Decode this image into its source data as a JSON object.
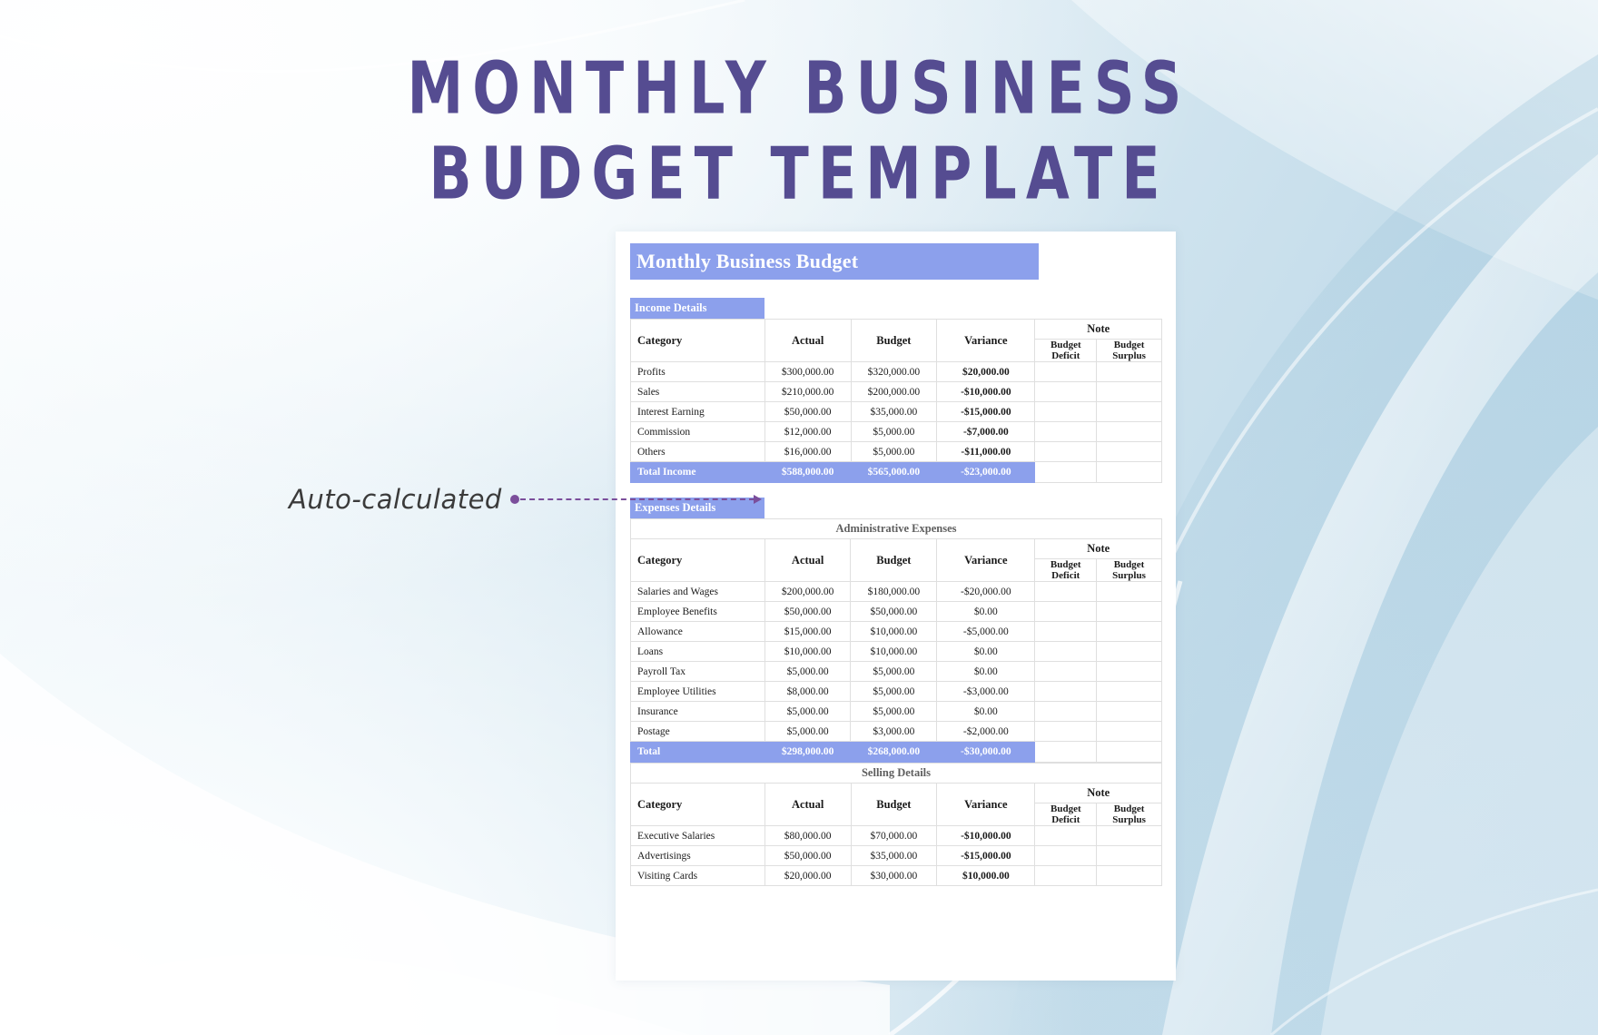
{
  "page": {
    "title_line_1": "MONTHLY BUSINESS",
    "title_line_2": "BUDGET TEMPLATE",
    "title_color": "#554C91",
    "accent_color": "#8CA0EC",
    "annotation_color": "#7B4E9B",
    "background_color": "#C3DCEA"
  },
  "annotation": {
    "label": "Auto-calculated"
  },
  "document": {
    "banner": "Monthly Business Budget",
    "income_tab": "Income Details",
    "expenses_tab": "Expenses Details",
    "columns": {
      "category": "Category",
      "actual": "Actual",
      "budget": "Budget",
      "variance": "Variance",
      "note": "Note",
      "budget_deficit": "Budget Deficit",
      "budget_deficit_l1": "Budget",
      "budget_deficit_l2": "Deficit",
      "budget_surplus_l1": "Budget",
      "budget_surplus_l2": "Surplus"
    },
    "income": {
      "rows": [
        {
          "category": "Profits",
          "actual": "$300,000.00",
          "budget": "$320,000.00",
          "variance": "$20,000.00",
          "deficit": "",
          "surplus": ""
        },
        {
          "category": "Sales",
          "actual": "$210,000.00",
          "budget": "$200,000.00",
          "variance": "-$10,000.00",
          "deficit": "",
          "surplus": ""
        },
        {
          "category": "Interest Earning",
          "actual": "$50,000.00",
          "budget": "$35,000.00",
          "variance": "-$15,000.00",
          "deficit": "",
          "surplus": ""
        },
        {
          "category": "Commission",
          "actual": "$12,000.00",
          "budget": "$5,000.00",
          "variance": "-$7,000.00",
          "deficit": "",
          "surplus": ""
        },
        {
          "category": "Others",
          "actual": "$16,000.00",
          "budget": "$5,000.00",
          "variance": "-$11,000.00",
          "deficit": "",
          "surplus": ""
        }
      ],
      "total": {
        "category": "Total Income",
        "actual": "$588,000.00",
        "budget": "$565,000.00",
        "variance": "-$23,000.00",
        "deficit": "",
        "surplus": ""
      }
    },
    "administrative": {
      "section_title": "Administrative Expenses",
      "rows": [
        {
          "category": "Salaries and Wages",
          "actual": "$200,000.00",
          "budget": "$180,000.00",
          "variance": "-$20,000.00",
          "deficit": "",
          "surplus": ""
        },
        {
          "category": "Employee Benefits",
          "actual": "$50,000.00",
          "budget": "$50,000.00",
          "variance": "$0.00",
          "deficit": "",
          "surplus": ""
        },
        {
          "category": "Allowance",
          "actual": "$15,000.00",
          "budget": "$10,000.00",
          "variance": "-$5,000.00",
          "deficit": "",
          "surplus": ""
        },
        {
          "category": "Loans",
          "actual": "$10,000.00",
          "budget": "$10,000.00",
          "variance": "$0.00",
          "deficit": "",
          "surplus": ""
        },
        {
          "category": "Payroll Tax",
          "actual": "$5,000.00",
          "budget": "$5,000.00",
          "variance": "$0.00",
          "deficit": "",
          "surplus": ""
        },
        {
          "category": "Employee Utilities",
          "actual": "$8,000.00",
          "budget": "$5,000.00",
          "variance": "-$3,000.00",
          "deficit": "",
          "surplus": ""
        },
        {
          "category": "Insurance",
          "actual": "$5,000.00",
          "budget": "$5,000.00",
          "variance": "$0.00",
          "deficit": "",
          "surplus": ""
        },
        {
          "category": "Postage",
          "actual": "$5,000.00",
          "budget": "$3,000.00",
          "variance": "-$2,000.00",
          "deficit": "",
          "surplus": ""
        }
      ],
      "total": {
        "category": "Total",
        "actual": "$298,000.00",
        "budget": "$268,000.00",
        "variance": "-$30,000.00",
        "deficit": "",
        "surplus": ""
      }
    },
    "selling": {
      "section_title": "Selling Details",
      "rows": [
        {
          "category": "Executive Salaries",
          "actual": "$80,000.00",
          "budget": "$70,000.00",
          "variance": "-$10,000.00",
          "deficit": "",
          "surplus": ""
        },
        {
          "category": "Advertisings",
          "actual": "$50,000.00",
          "budget": "$35,000.00",
          "variance": "-$15,000.00",
          "deficit": "",
          "surplus": ""
        },
        {
          "category": "Visiting Cards",
          "actual": "$20,000.00",
          "budget": "$30,000.00",
          "variance": "$10,000.00",
          "deficit": "",
          "surplus": ""
        }
      ]
    }
  }
}
